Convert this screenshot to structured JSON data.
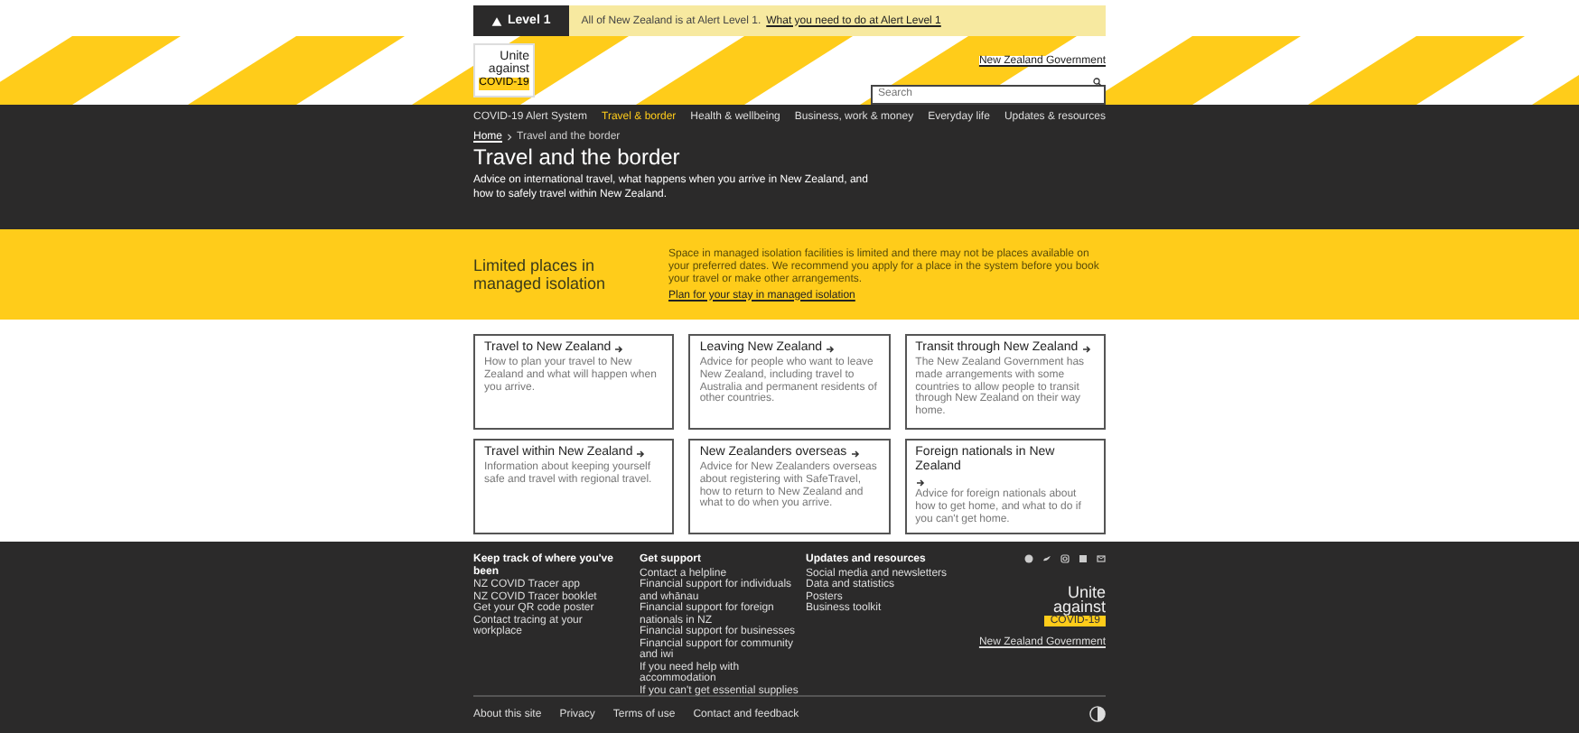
{
  "alert": {
    "level": "Level 1",
    "message": "All of New Zealand is at Alert Level 1.",
    "link": "What you need to do at Alert Level 1"
  },
  "header": {
    "logo": {
      "line1": "Unite",
      "line2": "against",
      "tag": "COVID-19"
    },
    "government": "New Zealand Government",
    "search": {
      "placeholder": "Search"
    }
  },
  "nav": [
    {
      "label": "COVID-19 Alert System",
      "selected": false
    },
    {
      "label": "Travel & border",
      "selected": true
    },
    {
      "label": "Health & wellbeing",
      "selected": false
    },
    {
      "label": "Business, work & money",
      "selected": false
    },
    {
      "label": "Everyday life",
      "selected": false
    },
    {
      "label": "Updates & resources",
      "selected": false
    }
  ],
  "breadcrumb": [
    "Home",
    "Travel and the border"
  ],
  "hero": {
    "title": "Travel and the border",
    "description": "Advice on international travel, what happens when you arrive in New Zealand, and how to safely travel within New Zealand."
  },
  "notice": {
    "heading": "Limited places in managed isolation",
    "text": "Space in managed isolation facilities is limited and there may not be places available on your preferred dates. We recommend you apply for a place in the system before you book your travel or make other arrangements.",
    "link": "Plan for your stay in managed isolation"
  },
  "cards": [
    {
      "title": "Travel to New Zealand",
      "text": "How to plan your travel to New Zealand and what will happen when you arrive."
    },
    {
      "title": "Leaving New Zealand",
      "text": "Advice for people who want to leave New Zealand, including travel to Australia and permanent residents of other countries."
    },
    {
      "title": "Transit through New Zealand",
      "text": "The New Zealand Government has made arrangements with some countries to allow people to transit through New Zealand on their way home."
    },
    {
      "title": "Travel within New Zealand",
      "text": "Information about keeping yourself safe and travel with regional travel."
    },
    {
      "title": "New Zealanders overseas",
      "text": "Advice for New Zealanders overseas about registering with SafeTravel, how to return to New Zealand and what to do when you arrive."
    },
    {
      "title": "Foreign nationals in New Zealand",
      "text": "Advice for foreign nationals about how to get home, and what to do if you can't get home."
    }
  ],
  "footer": {
    "columns": [
      {
        "heading": "Keep track of where you've been",
        "links": [
          "NZ COVID Tracer app",
          "NZ COVID Tracer booklet",
          "Get your QR code poster",
          "Contact tracing at your workplace"
        ]
      },
      {
        "heading": "Get support",
        "links": [
          "Contact a helpline",
          "Financial support for individuals and whānau",
          "Financial support for foreign nationals in NZ",
          "Financial support for businesses",
          "Financial support for community and iwi",
          "If you need help with accommodation",
          "If you can't get essential supplies"
        ]
      },
      {
        "heading": "Updates and resources",
        "links": [
          "Social media and newsletters",
          "Data and statistics",
          "Posters",
          "Business toolkit"
        ]
      }
    ],
    "social": [
      {
        "kind": "circle"
      },
      {
        "kind": "bird"
      },
      {
        "kind": "camera"
      },
      {
        "kind": "in"
      },
      {
        "kind": "mail"
      }
    ],
    "logo": {
      "line1": "Unite",
      "line2": "against",
      "tag": "COVID-19"
    },
    "government": "New Zealand Government",
    "links": [
      "About this site",
      "Privacy",
      "Terms of use",
      "Contact and feedback"
    ]
  }
}
